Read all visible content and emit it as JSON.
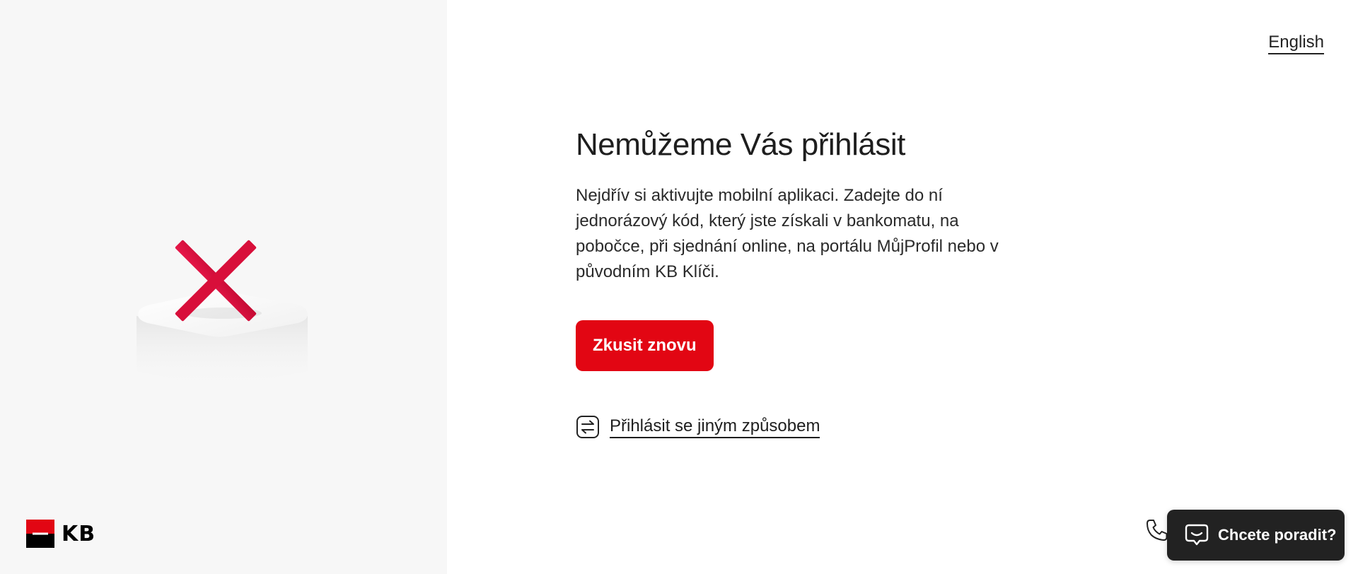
{
  "brand": {
    "logo_text": "KB",
    "logo_colors": {
      "top": "#e20613",
      "bottom": "#000000"
    }
  },
  "language_switch": {
    "label": "English"
  },
  "main": {
    "title": "Nemůžeme Vás přihlásit",
    "description": "Nejdřív si aktivujte mobilní aplikaci. Zadejte do ní jednorázový kód, který jste získali v bankomatu, na pobočce, při sjednání online, na portálu MůjProfil nebo v původním KB Klíči.",
    "retry_button": "Zkusit znovu",
    "alt_login_link": "Přihlásit se jiným způsobem",
    "alt_login_icon": "swap-arrows-icon"
  },
  "illustration": {
    "icon": "error-cross-icon",
    "accent_color": "#d80f3a"
  },
  "support": {
    "phone_icon": "phone-icon",
    "chat_button": "Chcete poradit?",
    "chat_icon": "chat-bubble-icon"
  },
  "colors": {
    "accent": "#e20613",
    "text": "#222222",
    "left_panel_bg": "#f7f7f7",
    "chat_bg": "#222222"
  }
}
